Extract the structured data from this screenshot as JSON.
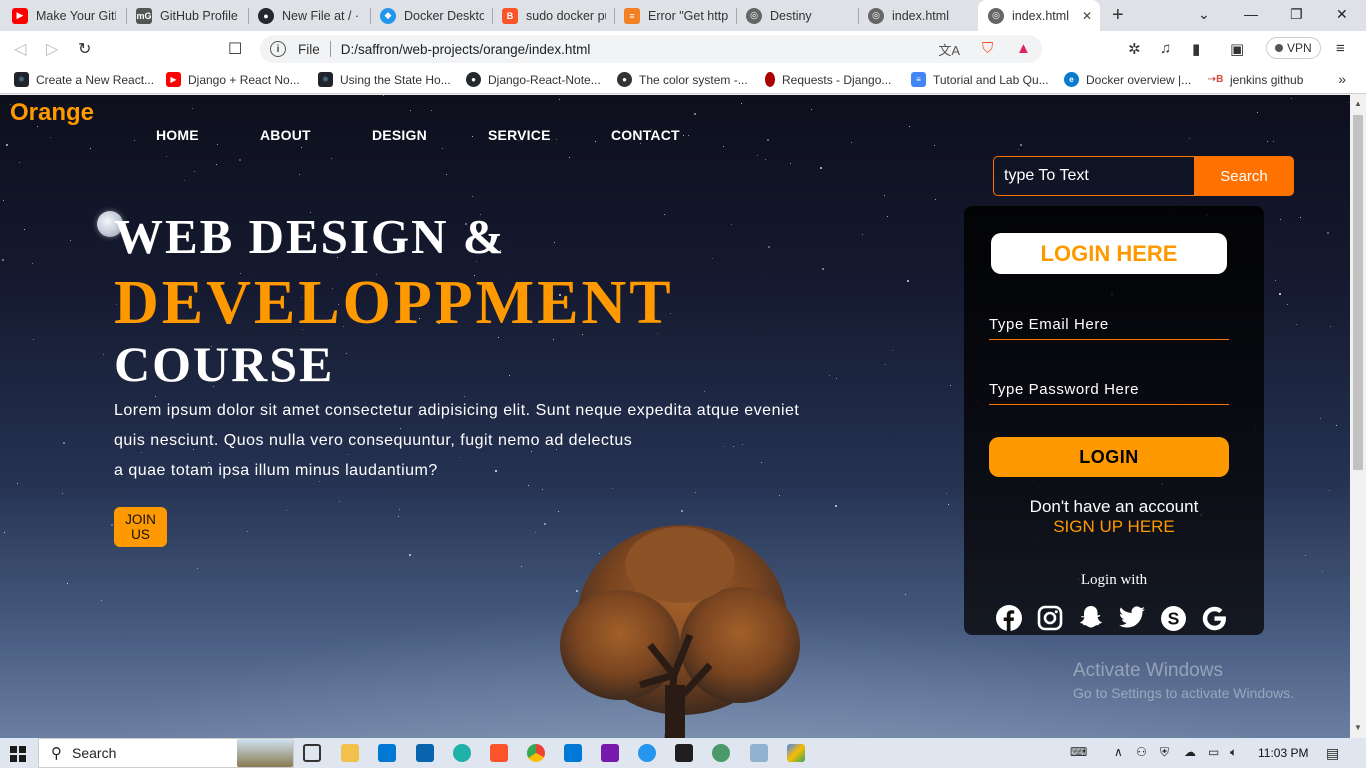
{
  "browser": {
    "tabs": [
      {
        "label": "Make Your GitH",
        "icon": "youtube-icon",
        "color": "#ff0000"
      },
      {
        "label": "GitHub Profile R",
        "icon": "mg-icon",
        "color": "#555555"
      },
      {
        "label": "New File at / · R",
        "icon": "github-icon",
        "color": "#24292e"
      },
      {
        "label": "Docker Desktop",
        "icon": "docker-icon",
        "color": "#2496ed"
      },
      {
        "label": "sudo docker pu",
        "icon": "brave-icon",
        "color": "#fb542b"
      },
      {
        "label": "Error \"Get https",
        "icon": "stackoverflow-icon",
        "color": "#f48024"
      },
      {
        "label": "Destiny",
        "icon": "globe-icon",
        "color": "#666666"
      },
      {
        "label": "index.html",
        "icon": "globe-icon",
        "color": "#666666"
      },
      {
        "label": "index.html",
        "icon": "globe-icon",
        "color": "#666666",
        "active": true
      }
    ],
    "address": {
      "scheme_label": "File",
      "url": "D:/saffron/web-projects/orange/index.html"
    },
    "vpn_label": "VPN",
    "bookmarks": [
      {
        "label": "Create a New React...",
        "icon": "react-icon",
        "color": "#20232a"
      },
      {
        "label": "Django + React No...",
        "icon": "youtube-icon",
        "color": "#ff0000"
      },
      {
        "label": "Using the State Ho...",
        "icon": "react-icon",
        "color": "#20232a"
      },
      {
        "label": "Django-React-Note...",
        "icon": "github-icon",
        "color": "#24292e"
      },
      {
        "label": "The color system -...",
        "icon": "github-icon",
        "color": "#333333"
      },
      {
        "label": "Requests - Django...",
        "icon": "pin-icon",
        "color": "#aa0000"
      },
      {
        "label": "Tutorial and Lab Qu...",
        "icon": "docs-icon",
        "color": "#4285f4"
      },
      {
        "label": "Docker overview |...",
        "icon": "edge-icon",
        "color": "#0a7cd0"
      },
      {
        "label": "jenkins github",
        "icon": "jenkins-icon",
        "color": "#d24939"
      }
    ]
  },
  "page": {
    "brand": "Orange",
    "nav": [
      "HOME",
      "ABOUT",
      "DESIGN",
      "SERVICE",
      "CONTACT"
    ],
    "search": {
      "placeholder": "type To Text",
      "button": "Search"
    },
    "hero": {
      "line1": "WEB DESIGN &",
      "line2": "DEVELOPPMENT",
      "line3": "COURSE",
      "para1": "Lorem ipsum dolor sit amet consectetur adipisicing elit. Sunt neque expedita atque eveniet",
      "para2": "quis nesciunt. Quos nulla vero consequuntur, fugit nemo ad delectus",
      "para3": "a quae totam ipsa illum minus laudantium?",
      "join": "JOIN US"
    },
    "login": {
      "title": "LOGIN HERE",
      "email_placeholder": "Type Email Here",
      "password_placeholder": "Type Password Here",
      "button": "LOGIN",
      "no_account": "Don't have an account",
      "signup": "SIGN UP HERE",
      "login_with": "Login with",
      "socials": [
        "facebook-icon",
        "instagram-icon",
        "snapchat-icon",
        "twitter-icon",
        "skype-icon",
        "google-icon"
      ]
    },
    "watermark": {
      "line1": "Activate Windows",
      "line2": "Go to Settings to activate Windows."
    }
  },
  "taskbar": {
    "search": "Search",
    "time": "11:03 PM"
  },
  "colors": {
    "accent": "#ff9900",
    "search_accent": "#ff7200"
  }
}
